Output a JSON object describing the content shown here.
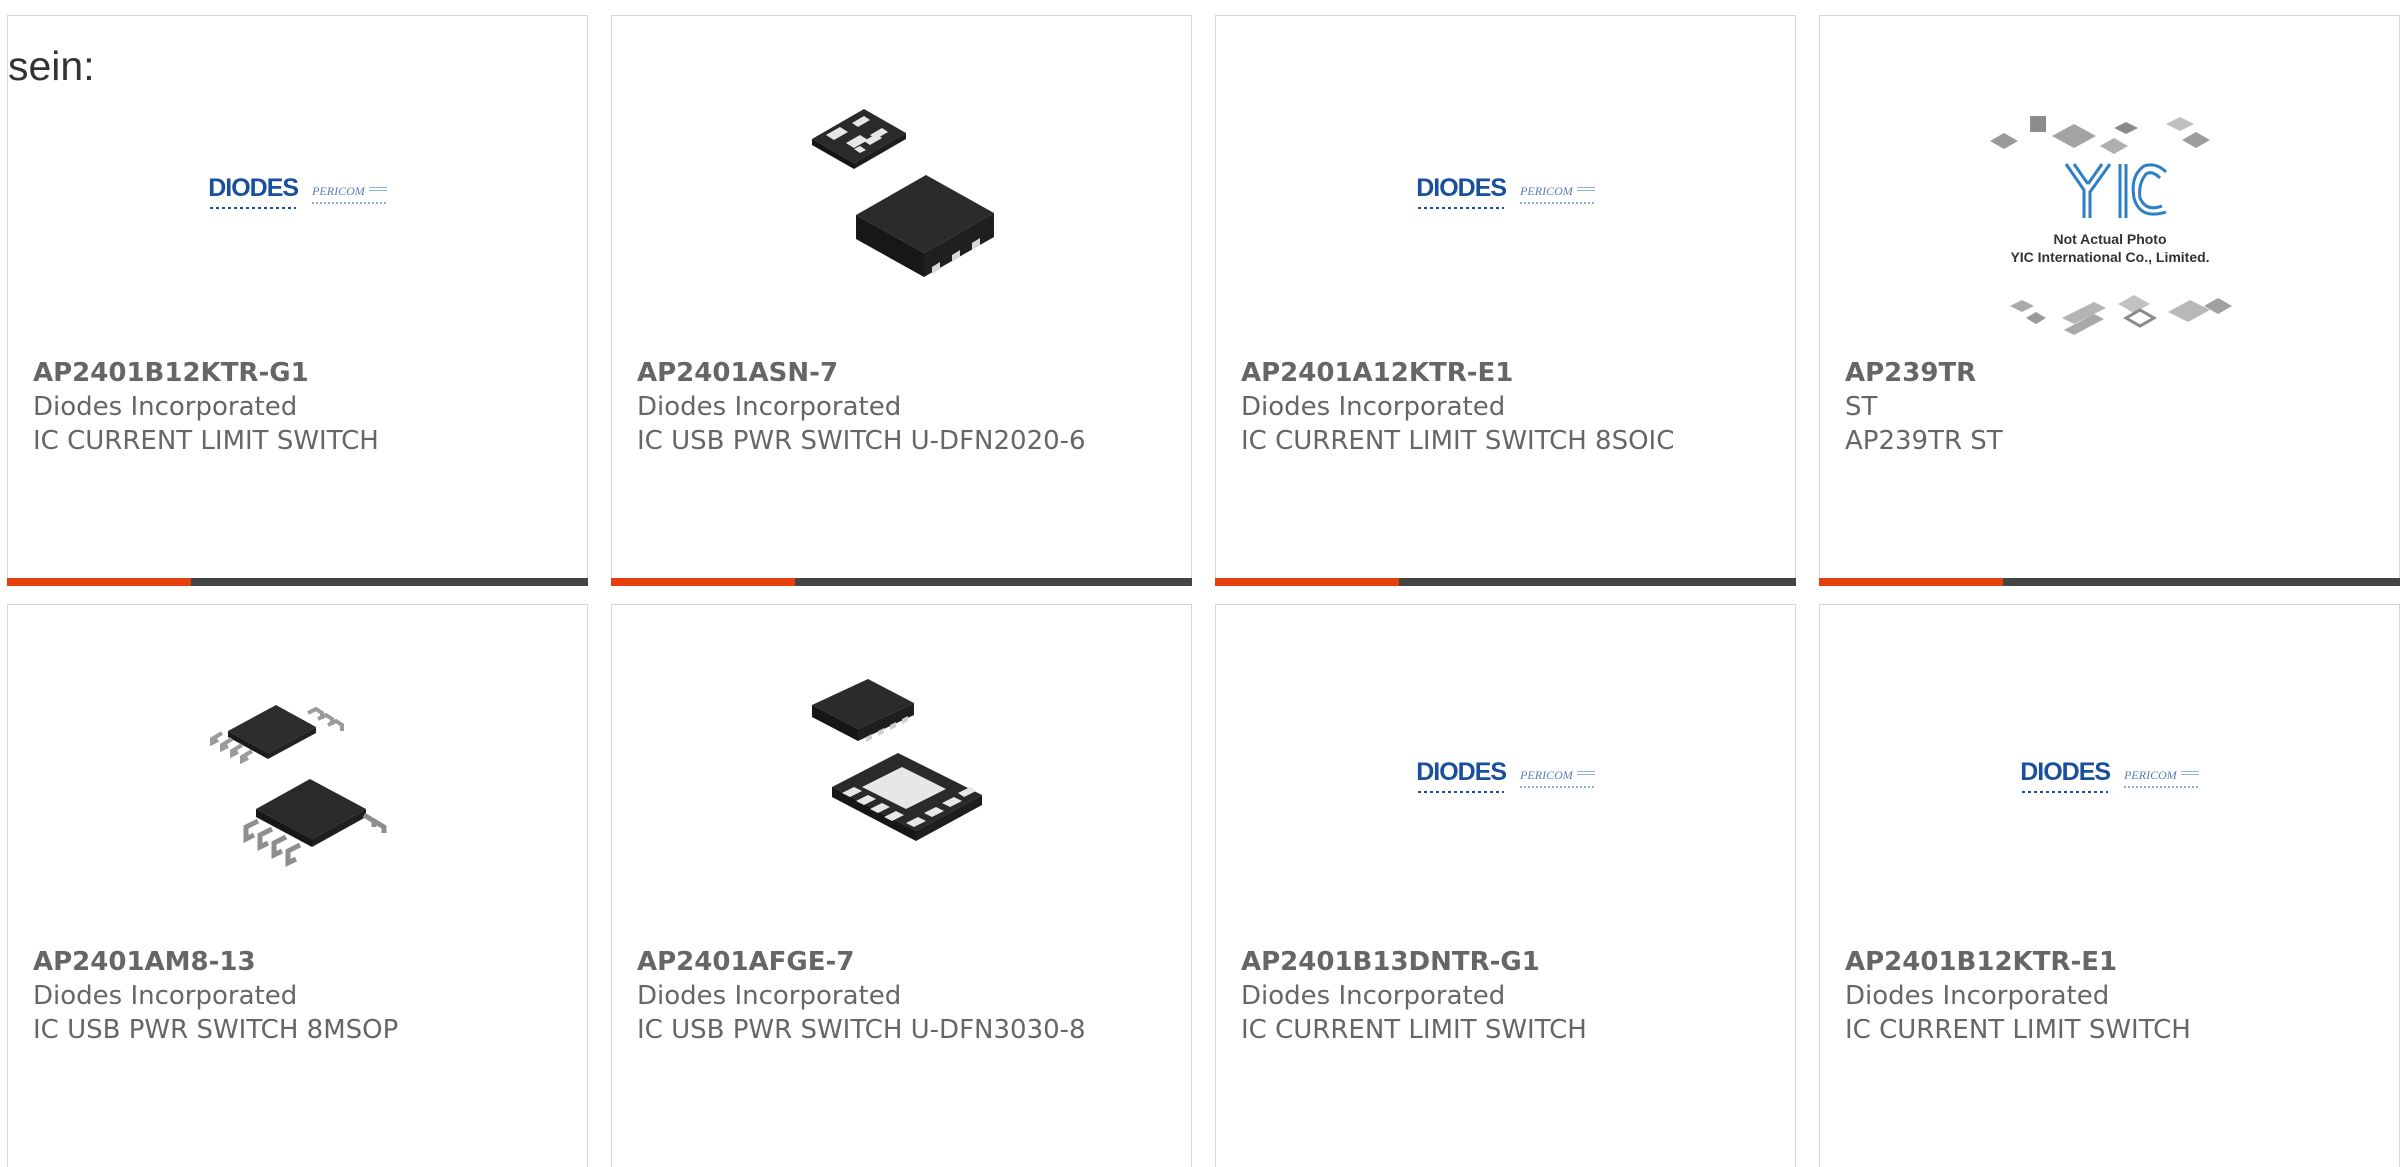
{
  "intro_text": "sein:",
  "colors": {
    "accent": "#e8400c",
    "bar": "#444444",
    "border": "#d7d7d7",
    "text": "#666666"
  },
  "products": [
    {
      "part": "AP2401B12KTR-G1",
      "manufacturer": "Diodes Incorporated",
      "description": "IC CURRENT LIMIT SWITCH",
      "image": "diodes-pericom-logo"
    },
    {
      "part": "AP2401ASN-7",
      "manufacturer": "Diodes Incorporated",
      "description": "IC USB PWR SWITCH U-DFN2020-6",
      "image": "udfn-6-package"
    },
    {
      "part": "AP2401A12KTR-E1",
      "manufacturer": "Diodes Incorporated",
      "description": "IC CURRENT LIMIT SWITCH 8SOIC",
      "image": "diodes-pericom-logo"
    },
    {
      "part": "AP239TR",
      "manufacturer": "ST",
      "description": "AP239TR ST",
      "image": "yic-placeholder"
    },
    {
      "part": "AP2401AM8-13",
      "manufacturer": "Diodes Incorporated",
      "description": "IC USB PWR SWITCH 8MSOP",
      "image": "msop-8-package"
    },
    {
      "part": "AP2401AFGE-7",
      "manufacturer": "Diodes Incorporated",
      "description": "IC USB PWR SWITCH U-DFN3030-8",
      "image": "udfn-8-package"
    },
    {
      "part": "AP2401B13DNTR-G1",
      "manufacturer": "Diodes Incorporated",
      "description": "IC CURRENT LIMIT SWITCH",
      "image": "diodes-pericom-logo"
    },
    {
      "part": "AP2401B12KTR-E1",
      "manufacturer": "Diodes Incorporated",
      "description": "IC CURRENT LIMIT SWITCH",
      "image": "diodes-pericom-logo"
    }
  ],
  "logos": {
    "diodes_word": "DIODES",
    "pericom_word": "PERICOM"
  },
  "yic": {
    "logo_text": "YIC",
    "line1": "Not Actual Photo",
    "line2": "YIC International Co., Limited."
  }
}
